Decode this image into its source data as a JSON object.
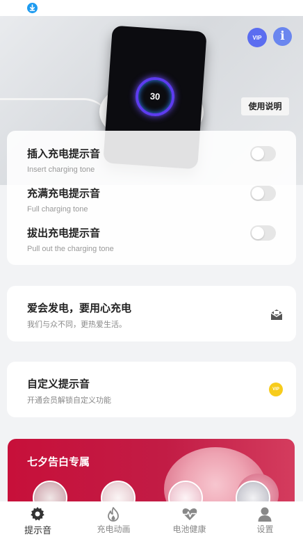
{
  "tones": [
    {
      "title": "插入充电提示音",
      "subtitle": "Insert charging tone",
      "enabled": false
    },
    {
      "title": "充满充电提示音",
      "subtitle": "Full charging tone",
      "enabled": false
    },
    {
      "title": "拔出充电提示音",
      "subtitle": "Pull out the charging tone",
      "enabled": false
    }
  ],
  "header": {
    "usage_button": "使用说明",
    "vip_badge": "VIP",
    "info_icon": "i",
    "phone_display": "30"
  },
  "promo": {
    "title": "爱会发电，要用心充电",
    "subtitle": "我们与众不同，更热爱生活。"
  },
  "custom": {
    "title": "自定义提示音",
    "subtitle": "开通会员解锁自定义功能",
    "vip_badge": "VIP"
  },
  "banner": {
    "title": "七夕告白专属"
  },
  "tabs": [
    {
      "label": "提示音",
      "icon": "gear-icon",
      "active": true
    },
    {
      "label": "充电动画",
      "icon": "flame-icon",
      "active": false
    },
    {
      "label": "电池健康",
      "icon": "heartbeat-icon",
      "active": false
    },
    {
      "label": "设置",
      "icon": "person-icon",
      "active": false
    }
  ],
  "colors": {
    "accent": "#5b6df0",
    "banner": "#c7103a",
    "vip_gold": "#f7cc1c",
    "download": "#1e9bf0"
  }
}
